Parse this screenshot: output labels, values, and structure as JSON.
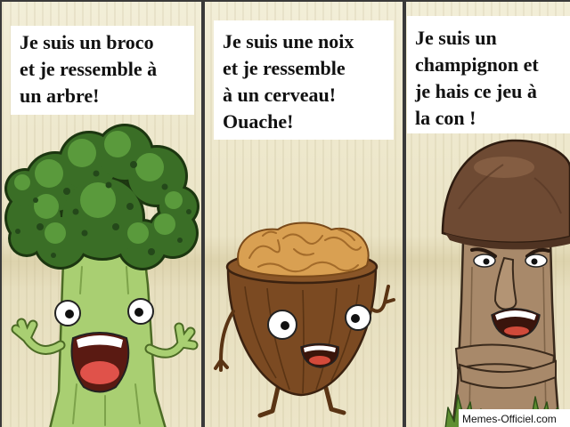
{
  "panels": [
    {
      "lines": [
        "Je suis un broco",
        "et je ressemble à",
        "un arbre!"
      ]
    },
    {
      "lines": [
        "Je suis une noix",
        "et je ressemble",
        "à un cerveau!",
        "Ouache!"
      ]
    },
    {
      "lines": [
        "Je suis un",
        "champignon et",
        "je hais ce jeu à",
        "la con !"
      ]
    }
  ],
  "watermark": "Memes-Officiel.com",
  "colors": {
    "panel_border": "#3a3a3a",
    "caption_background": "#ffffff",
    "caption_text": "#111111",
    "watermark_background": "#ffffff",
    "broccoli_green": "#3a6e26",
    "broccoli_stalk": "#a9cf72",
    "walnut_shell": "#7b4a22",
    "walnut_kernel": "#d9a052",
    "mushroom_cap": "#6e4a33",
    "mushroom_stem": "#a8896a"
  }
}
